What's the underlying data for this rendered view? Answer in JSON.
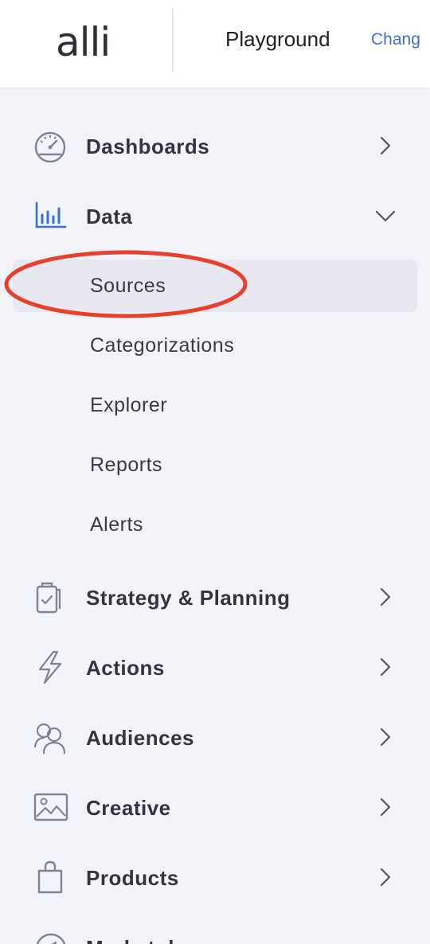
{
  "header": {
    "logo_text": "alli",
    "workspace_name": "Playground",
    "change_link": "Chang"
  },
  "nav": {
    "items": [
      {
        "label": "Dashboards",
        "icon": "speedometer-icon",
        "expanded": false
      },
      {
        "label": "Data",
        "icon": "bar-chart-icon",
        "expanded": true,
        "active_color": "#3a6fd8"
      },
      {
        "label": "Strategy & Planning",
        "icon": "clipboard-icon",
        "expanded": false
      },
      {
        "label": "Actions",
        "icon": "lightning-icon",
        "expanded": false
      },
      {
        "label": "Audiences",
        "icon": "users-icon",
        "expanded": false
      },
      {
        "label": "Creative",
        "icon": "image-icon",
        "expanded": false
      },
      {
        "label": "Products",
        "icon": "shopping-bag-icon",
        "expanded": false
      },
      {
        "label": "Marketplace",
        "icon": "compass-icon",
        "expanded": false
      }
    ],
    "data_subitems": [
      {
        "label": "Sources",
        "active": true
      },
      {
        "label": "Categorizations",
        "active": false
      },
      {
        "label": "Explorer",
        "active": false
      },
      {
        "label": "Reports",
        "active": false
      },
      {
        "label": "Alerts",
        "active": false
      }
    ]
  },
  "colors": {
    "accent": "#3a6fd8",
    "annotation": "#e8402a",
    "background": "#f3f4fa"
  }
}
